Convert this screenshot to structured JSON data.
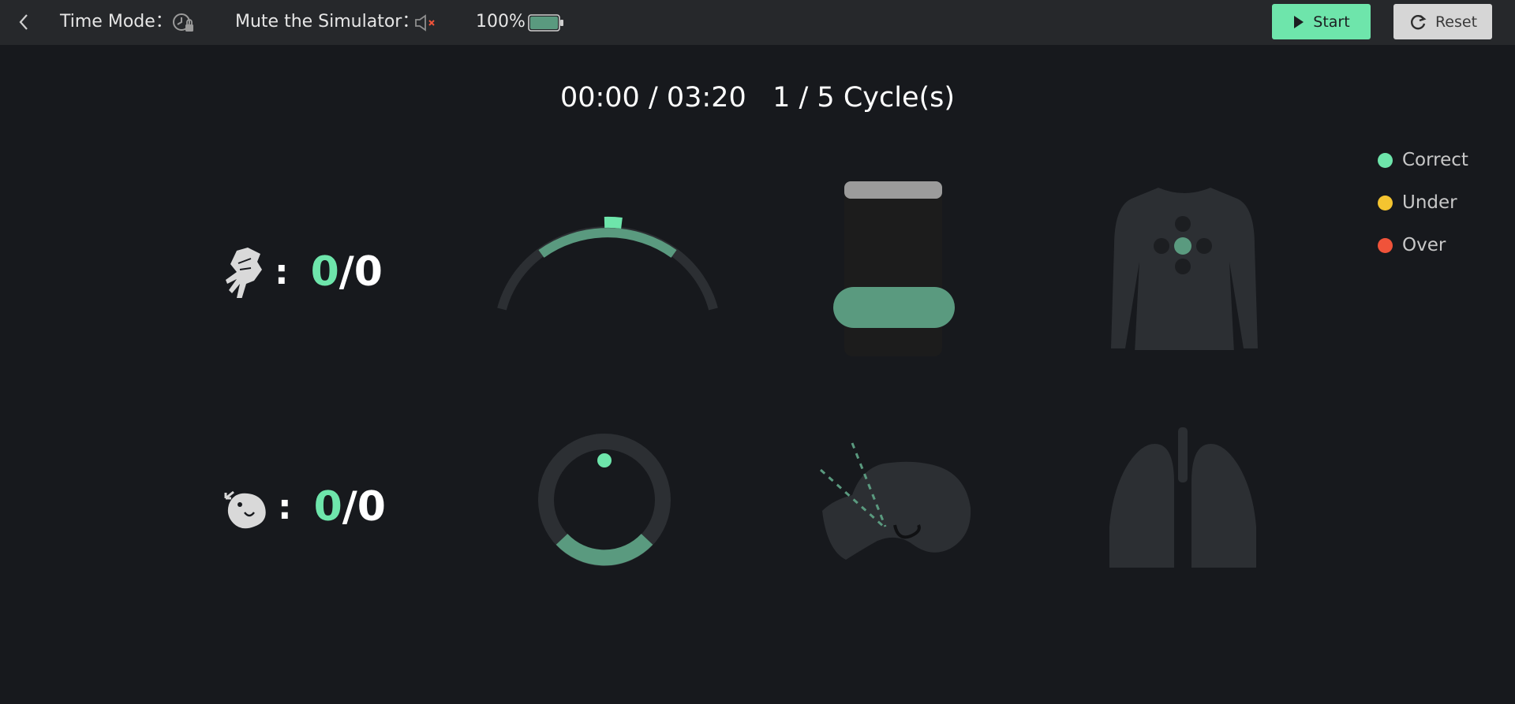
{
  "topbar": {
    "back_icon": "chevron-left-icon",
    "time_mode_label": "Time Mode：",
    "time_mode_icon": "clock-lock-icon",
    "mute_label": "Mute the Simulator：",
    "mute_icon": "speaker-muted-icon",
    "battery_percent": "100%",
    "battery_level": 1.0,
    "start_label": "Start",
    "reset_label": "Reset"
  },
  "session": {
    "timer": "00:00 / 03:20",
    "cycles": "1 / 5 Cycle(s)"
  },
  "legend": [
    {
      "label": "Correct",
      "color": "#6ee5ab"
    },
    {
      "label": "Under",
      "color": "#f4c430"
    },
    {
      "label": "Over",
      "color": "#f0533a"
    }
  ],
  "compressions": {
    "icon": "hands-compression-icon",
    "colon": ":",
    "correct": "0",
    "total": "/0"
  },
  "ventilations": {
    "icon": "rescue-breath-icon",
    "colon": ":",
    "correct": "0",
    "total": "/0"
  },
  "colors": {
    "accent": "#6ee5ab",
    "accent_dim": "#5a9a7f",
    "track": "#2c2f33",
    "background": "#17191d",
    "topbar": "#26282b"
  }
}
